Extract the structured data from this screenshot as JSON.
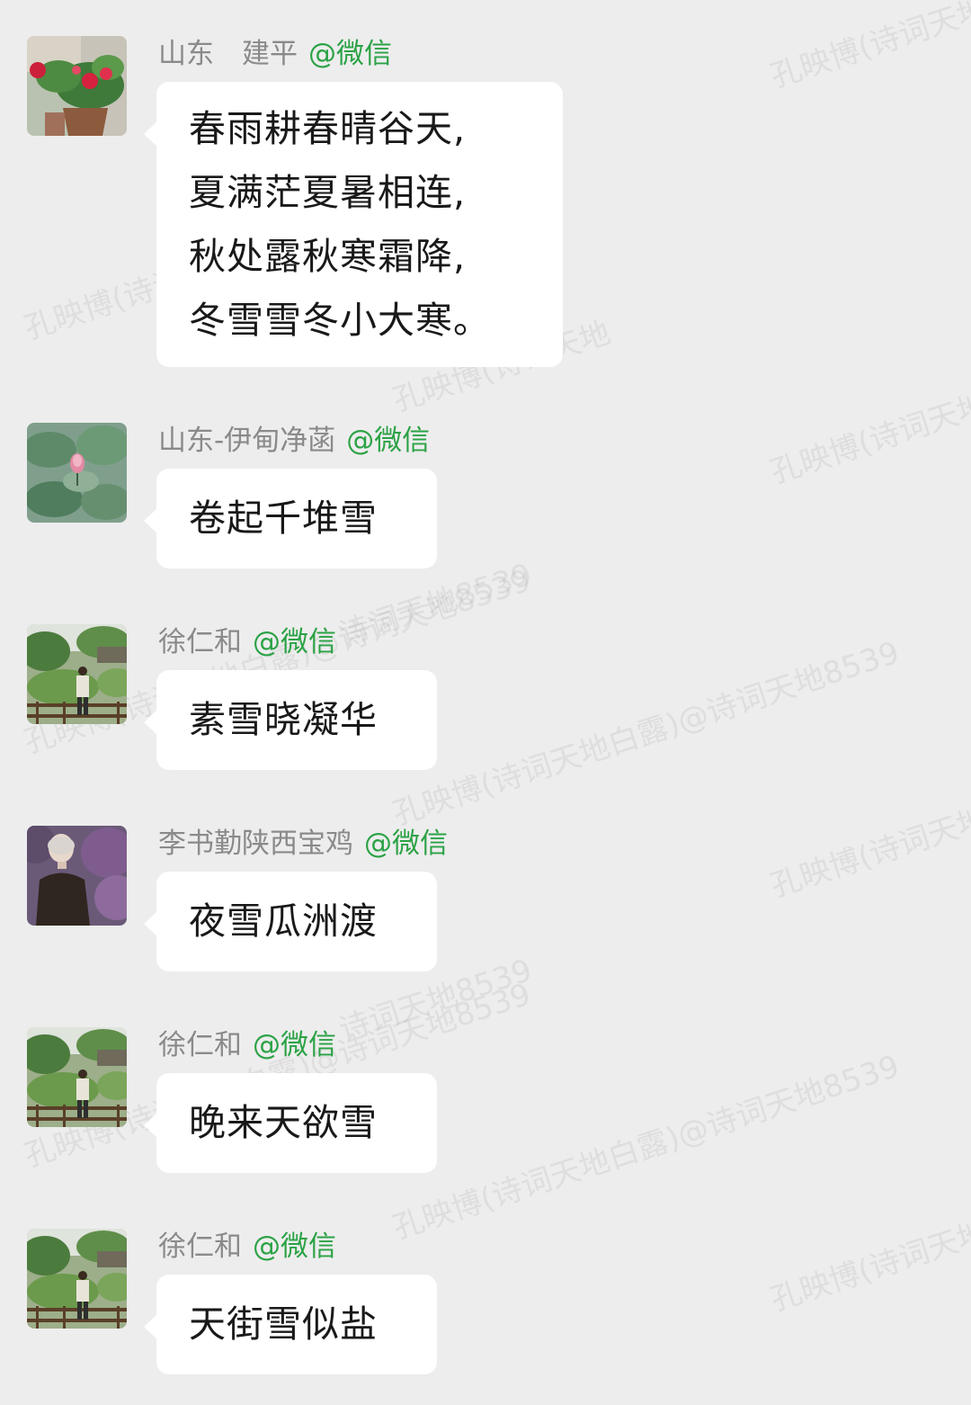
{
  "messages": [
    {
      "sender": "山东　建平",
      "platform": "@微信",
      "lines": [
        "春雨耕春晴谷天,",
        "夏满茫夏暑相连,",
        "秋处露秋寒霜降,",
        "冬雪雪冬小大寒。"
      ],
      "avatar": "red-flower-pot-avatar"
    },
    {
      "sender": "山东-伊甸净菡",
      "platform": "@微信",
      "lines": [
        "卷起千堆雪"
      ],
      "avatar": "lotus-pond-avatar"
    },
    {
      "sender": "徐仁和",
      "platform": "@微信",
      "lines": [
        "素雪晓凝华"
      ],
      "avatar": "garden-person-avatar"
    },
    {
      "sender": "李书勤陕西宝鸡",
      "platform": "@微信",
      "lines": [
        "夜雪瓜洲渡"
      ],
      "avatar": "portrait-flowers-avatar"
    },
    {
      "sender": "徐仁和",
      "platform": "@微信",
      "lines": [
        "晚来天欲雪"
      ],
      "avatar": "garden-person-avatar"
    },
    {
      "sender": "徐仁和",
      "platform": "@微信",
      "lines": [
        "天街雪似盐"
      ],
      "avatar": "garden-person-avatar"
    }
  ],
  "watermark": {
    "full": "孔映博(诗词天地白露)@诗词天地8539",
    "short": "孔映博(诗词天地",
    "tail": "诗词天地8539"
  },
  "colors": {
    "background": "#ededed",
    "bubble": "#ffffff",
    "platform": "#2ba245",
    "sender": "#8a8a8a"
  }
}
